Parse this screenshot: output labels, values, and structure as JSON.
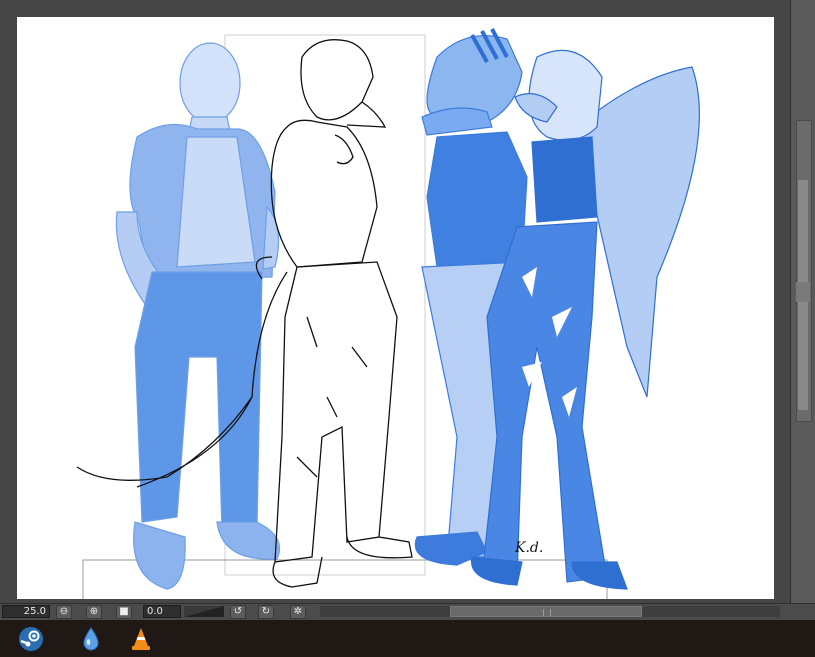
{
  "canvas": {
    "signature": "K.d."
  },
  "statusbar": {
    "zoom_value": "25.0",
    "zoom_out_icon": "zoom-out-icon",
    "zoom_in_icon": "zoom-in-icon",
    "fit_icon": "fit-screen-icon",
    "angle_value": "0.0",
    "rotate_left_icon": "rotate-left-icon",
    "rotate_right_icon": "rotate-right-icon",
    "reset_rotation_icon": "reset-rotation-icon"
  },
  "taskbar": {
    "apps": [
      {
        "icon": "steam-icon"
      },
      {
        "icon": "water-drop-icon"
      },
      {
        "icon": "vlc-cone-icon"
      }
    ]
  },
  "colors": {
    "blue_dark": "#3d7bdc",
    "blue_mid": "#6ea0ea",
    "blue_light": "#b9d0f4",
    "line": "#111111"
  }
}
